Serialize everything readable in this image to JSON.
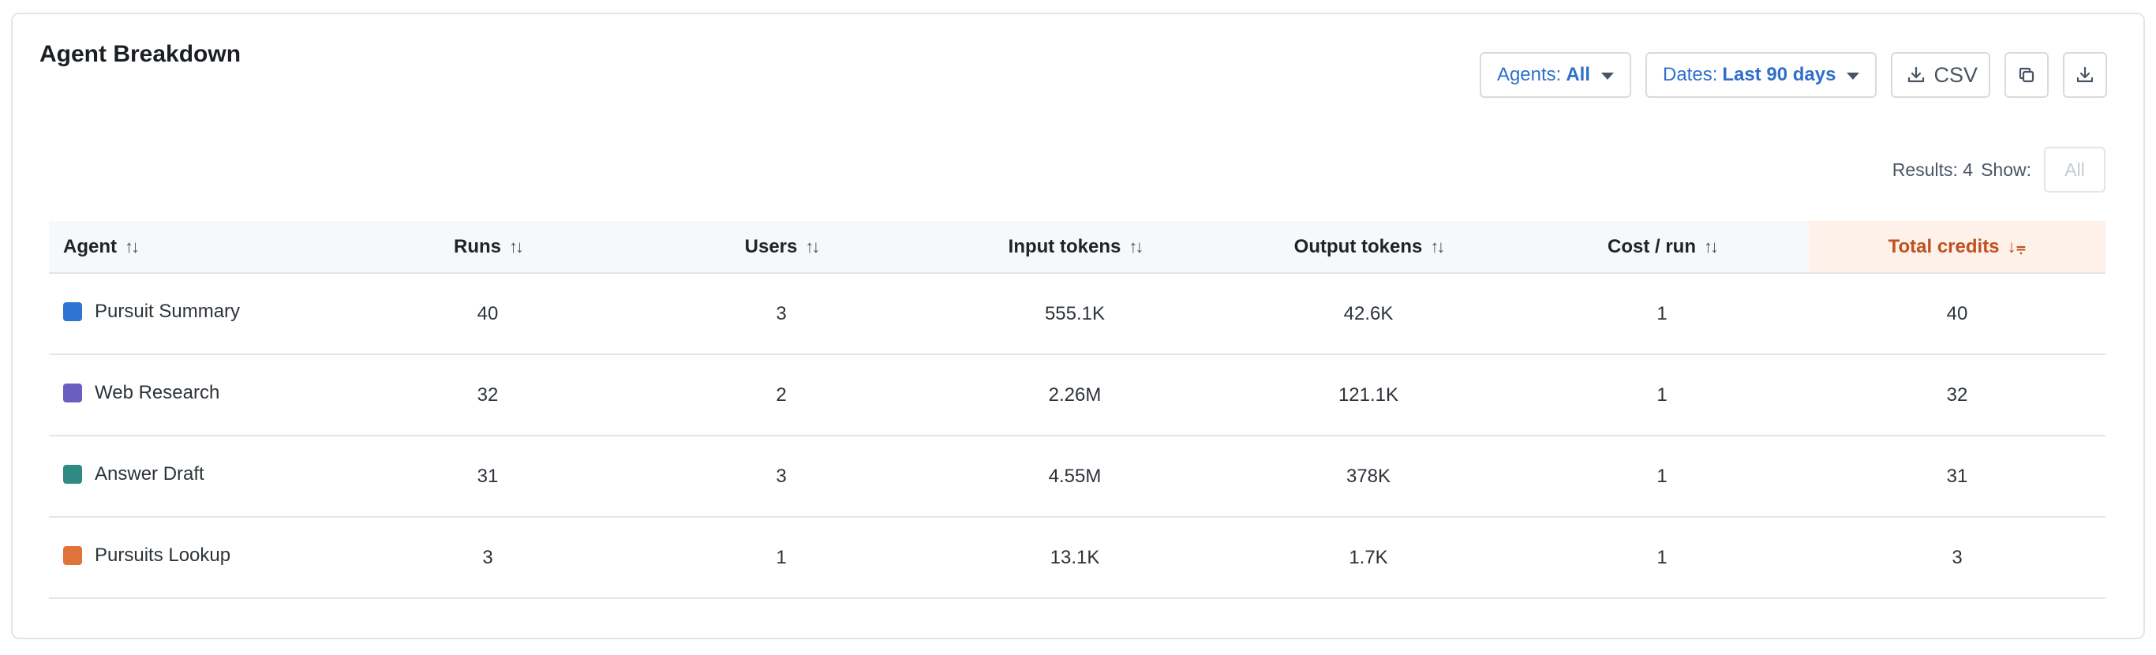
{
  "title": "Agent Breakdown",
  "filters": {
    "agents_label": "Agents:",
    "agents_value": "All",
    "dates_label": "Dates:",
    "dates_value": "Last 90 days"
  },
  "actions": {
    "csv_label": "CSV",
    "copy_icon": "copy-icon",
    "download_icon": "download-icon"
  },
  "results": {
    "label": "Results: 4",
    "show_label": "Show:",
    "show_value": "All"
  },
  "table": {
    "headers": {
      "agent": "Agent",
      "runs": "Runs",
      "users": "Users",
      "input_tokens": "Input tokens",
      "output_tokens": "Output tokens",
      "cost_run": "Cost / run",
      "total_credits": "Total credits"
    },
    "active_sort_color": "#c0501e",
    "rows": [
      {
        "agent": "Pursuit Summary",
        "color": "#2f74d0",
        "runs": "40",
        "users": "3",
        "input_tokens": "555.1K",
        "output_tokens": "42.6K",
        "cost_run": "1",
        "total_credits": "40"
      },
      {
        "agent": "Web Research",
        "color": "#6a5fc1",
        "runs": "32",
        "users": "2",
        "input_tokens": "2.26M",
        "output_tokens": "121.1K",
        "cost_run": "1",
        "total_credits": "32"
      },
      {
        "agent": "Answer Draft",
        "color": "#2f8a83",
        "runs": "31",
        "users": "3",
        "input_tokens": "4.55M",
        "output_tokens": "378K",
        "cost_run": "1",
        "total_credits": "31"
      },
      {
        "agent": "Pursuits Lookup",
        "color": "#e0733a",
        "runs": "3",
        "users": "1",
        "input_tokens": "13.1K",
        "output_tokens": "1.7K",
        "cost_run": "1",
        "total_credits": "3"
      }
    ]
  }
}
